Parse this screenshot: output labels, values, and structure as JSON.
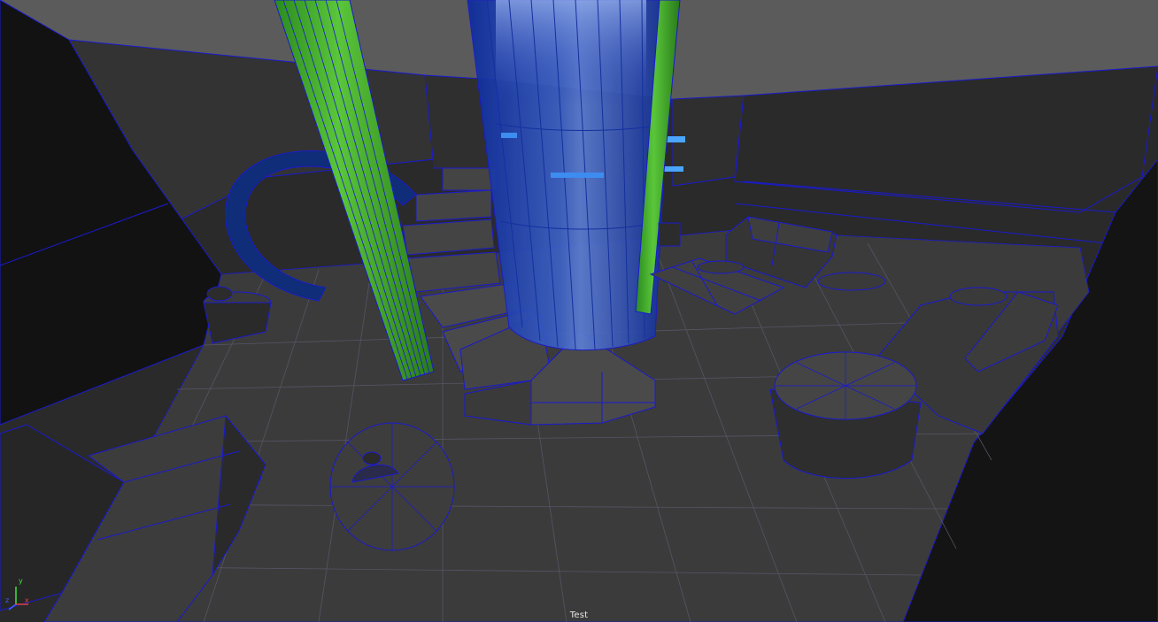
{
  "viewport": {
    "camera_label": "Test",
    "background_color": "#2a2a2a",
    "wireframe_color": "#1a1ad0"
  },
  "axis_gizmo": {
    "x_label": "x",
    "y_label": "y",
    "z_label": "z",
    "x_color": "#e04040",
    "y_color": "#40e040",
    "z_color": "#4060ff"
  },
  "materials": {
    "floor": "#3a3a3a",
    "wall": "#2f2f2f",
    "ceiling": "#5c5c5c",
    "glass_tube": "#1a3cc8",
    "pillar": "#3fa82a",
    "ring": "#0f2d78",
    "furniture": "#383838"
  }
}
